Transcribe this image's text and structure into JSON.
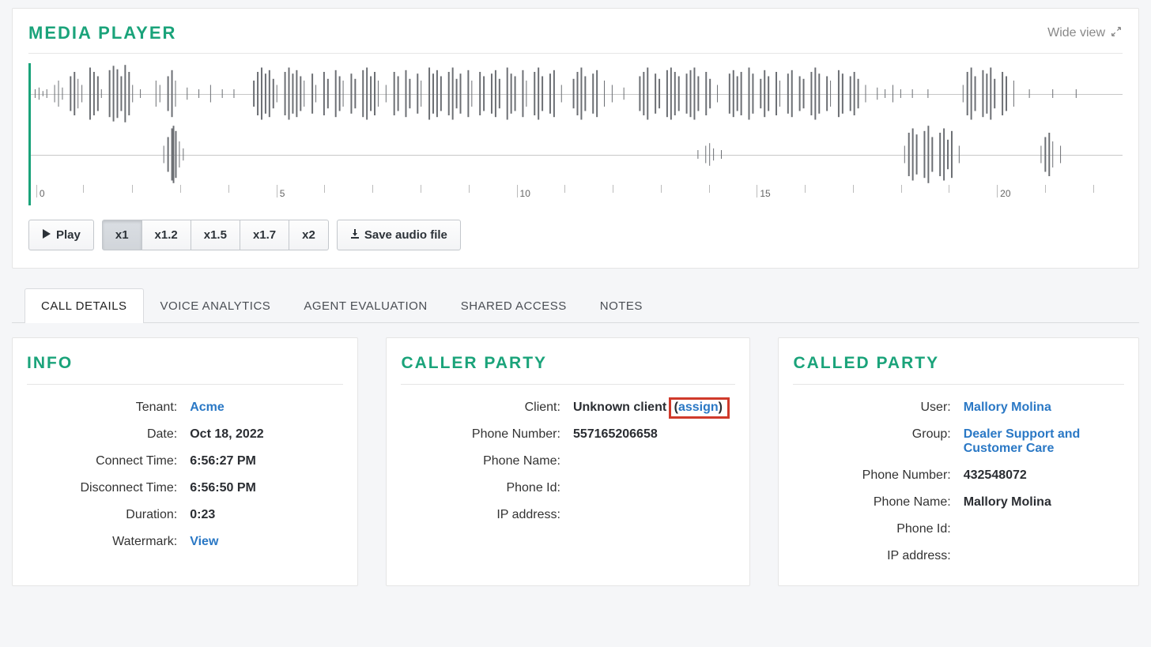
{
  "media_player": {
    "title": "MEDIA PLAYER",
    "wide_view": "Wide view",
    "play_label": "Play",
    "speed": {
      "x1": "x1",
      "x12": "x1.2",
      "x15": "x1.5",
      "x17": "x1.7",
      "x2": "x2"
    },
    "save_label": "Save audio file",
    "timeline": {
      "t0": "0",
      "t5": "5",
      "t10": "10",
      "t15": "15",
      "t20": "20"
    }
  },
  "tabs": {
    "call_details": "CALL DETAILS",
    "voice_analytics": "VOICE ANALYTICS",
    "agent_evaluation": "AGENT EVALUATION",
    "shared_access": "SHARED ACCESS",
    "notes": "NOTES"
  },
  "info": {
    "title": "INFO",
    "fields": {
      "tenant": {
        "label": "Tenant:",
        "value": "Acme"
      },
      "date": {
        "label": "Date:",
        "value": "Oct 18, 2022"
      },
      "connect_time": {
        "label": "Connect Time:",
        "value": "6:56:27 PM"
      },
      "disconnect_time": {
        "label": "Disconnect Time:",
        "value": "6:56:50 PM"
      },
      "duration": {
        "label": "Duration:",
        "value": "0:23"
      },
      "watermark": {
        "label": "Watermark:",
        "value": "View"
      }
    }
  },
  "caller": {
    "title": "CALLER PARTY",
    "fields": {
      "client": {
        "label": "Client:",
        "value": "Unknown client",
        "assign": "assign"
      },
      "phone_number": {
        "label": "Phone Number:",
        "value": "557165206658"
      },
      "phone_name": {
        "label": "Phone Name:",
        "value": ""
      },
      "phone_id": {
        "label": "Phone Id:",
        "value": ""
      },
      "ip_address": {
        "label": "IP address:",
        "value": ""
      }
    }
  },
  "called": {
    "title": "CALLED PARTY",
    "fields": {
      "user": {
        "label": "User:",
        "value": "Mallory Molina"
      },
      "group": {
        "label": "Group:",
        "value": "Dealer Support and Customer Care"
      },
      "phone_number": {
        "label": "Phone Number:",
        "value": "432548072"
      },
      "phone_name": {
        "label": "Phone Name:",
        "value": "Mallory Molina"
      },
      "phone_id": {
        "label": "Phone Id:",
        "value": ""
      },
      "ip_address": {
        "label": "IP address:",
        "value": ""
      }
    }
  }
}
